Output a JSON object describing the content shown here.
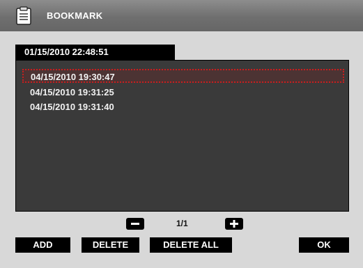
{
  "title": "BOOKMARK",
  "current_datetime": "01/15/2010 22:48:51",
  "bookmarks": [
    {
      "time": "04/15/2010 19:30:47"
    },
    {
      "time": "04/15/2010 19:31:25"
    },
    {
      "time": "04/15/2010 19:31:40"
    }
  ],
  "pager": {
    "page": "1/1",
    "prev_icon": "minus-icon",
    "next_icon": "plus-icon"
  },
  "buttons": {
    "add": "ADD",
    "delete": "DELETE",
    "delete_all": "DELETE ALL",
    "ok": "OK"
  },
  "colors": {
    "selection_border": "#c81e1e",
    "panel": "#3a3a3a",
    "titlebar": "#777777"
  }
}
